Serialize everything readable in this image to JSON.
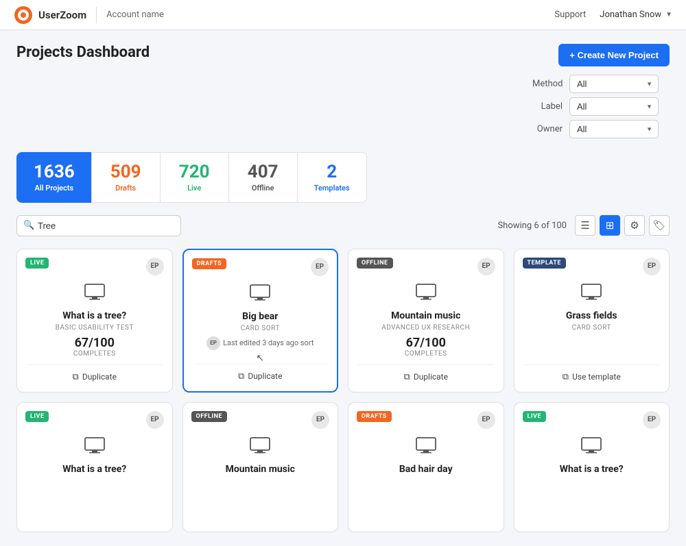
{
  "header": {
    "logo_text": "UserZoom",
    "account_name": "Account name",
    "support_label": "Support",
    "user_name": "Jonathan Snow"
  },
  "page": {
    "title": "Projects Dashboard",
    "create_btn": "+ Create New Project"
  },
  "filters": {
    "method_label": "Method",
    "method_value": "All",
    "label_label": "Label",
    "label_value": "All",
    "owner_label": "Owner",
    "owner_value": "All"
  },
  "stats": [
    {
      "number": "1636",
      "label": "All Projects",
      "type": "active"
    },
    {
      "number": "509",
      "label": "Drafts",
      "type": "drafts"
    },
    {
      "number": "720",
      "label": "Live",
      "type": "live"
    },
    {
      "number": "407",
      "label": "Offline",
      "type": "offline"
    },
    {
      "number": "2",
      "label": "Templates",
      "type": "templates"
    }
  ],
  "toolbar": {
    "search_placeholder": "Tree",
    "showing_text": "Showing 6 of 100"
  },
  "cards": [
    {
      "badge": "LIVE",
      "badge_type": "live",
      "avatar": "EP",
      "title": "What is a tree?",
      "subtitle": "BASIC USABILITY TEST",
      "stat": "67/100",
      "stat_label": "COMPLETES",
      "action": "Duplicate",
      "edited": null
    },
    {
      "badge": "DRAFTS",
      "badge_type": "drafts",
      "avatar": "EP",
      "title": "Big bear",
      "subtitle": "CARD SORT",
      "stat": null,
      "stat_label": null,
      "action": "Duplicate",
      "edited": "Last edited 3 days ago sort",
      "selected": true
    },
    {
      "badge": "OFFLINE",
      "badge_type": "offline",
      "avatar": "EP",
      "title": "Mountain music",
      "subtitle": "ADVANCED UX RESEARCH",
      "stat": "67/100",
      "stat_label": "COMPLETES",
      "action": "Duplicate",
      "edited": null
    },
    {
      "badge": "TEMPLATE",
      "badge_type": "template",
      "avatar": "EP",
      "title": "Grass fields",
      "subtitle": "CARD SORT",
      "stat": null,
      "stat_label": null,
      "action": "Use template",
      "edited": null
    },
    {
      "badge": "LIVE",
      "badge_type": "live",
      "avatar": "EP",
      "title": "What is a tree?",
      "subtitle": "",
      "stat": null,
      "stat_label": null,
      "action": null,
      "edited": null
    },
    {
      "badge": "OFFLINE",
      "badge_type": "offline",
      "avatar": "EP",
      "title": "Mountain music",
      "subtitle": "",
      "stat": null,
      "stat_label": null,
      "action": null,
      "edited": null
    },
    {
      "badge": "DRAFTS",
      "badge_type": "drafts",
      "avatar": "EP",
      "title": "Bad hair day",
      "subtitle": "",
      "stat": null,
      "stat_label": null,
      "action": null,
      "edited": null
    },
    {
      "badge": "LIVE",
      "badge_type": "live",
      "avatar": "EP",
      "title": "What is a tree?",
      "subtitle": "",
      "stat": null,
      "stat_label": null,
      "action": null,
      "edited": null
    }
  ]
}
